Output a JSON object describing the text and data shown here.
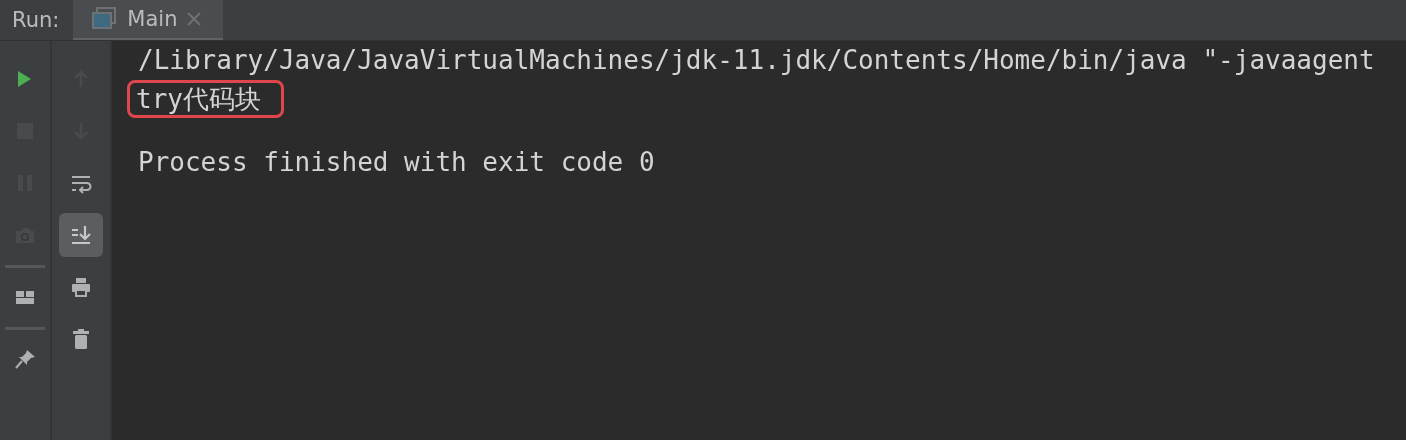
{
  "run_bar": {
    "label": "Run:",
    "tabs": [
      {
        "label": "Main",
        "selected": true,
        "closable": true
      }
    ]
  },
  "toolbar_left": [
    {
      "kind": "run",
      "disabled": false
    },
    {
      "kind": "stop",
      "disabled": true
    },
    {
      "kind": "pause",
      "disabled": true
    },
    {
      "kind": "camera",
      "disabled": true
    },
    {
      "kind": "separator"
    },
    {
      "kind": "layout",
      "disabled": false
    },
    {
      "kind": "separator"
    },
    {
      "kind": "pin",
      "disabled": false
    }
  ],
  "toolbar_right": [
    {
      "kind": "up",
      "disabled": true,
      "selected": false
    },
    {
      "kind": "down",
      "disabled": true,
      "selected": false
    },
    {
      "kind": "wrap",
      "disabled": false,
      "selected": false
    },
    {
      "kind": "scroll-end",
      "disabled": false,
      "selected": true
    },
    {
      "kind": "print",
      "disabled": false,
      "selected": false
    },
    {
      "kind": "trash",
      "disabled": false,
      "selected": false
    }
  ],
  "console": {
    "lines": [
      {
        "text": "/Library/Java/JavaVirtualMachines/jdk-11.jdk/Contents/Home/bin/java \"-javaagent",
        "highlighted": false
      },
      {
        "text": "try代码块",
        "highlighted": true
      },
      {
        "text": "Process finished with exit code 0",
        "highlighted": false
      }
    ]
  }
}
